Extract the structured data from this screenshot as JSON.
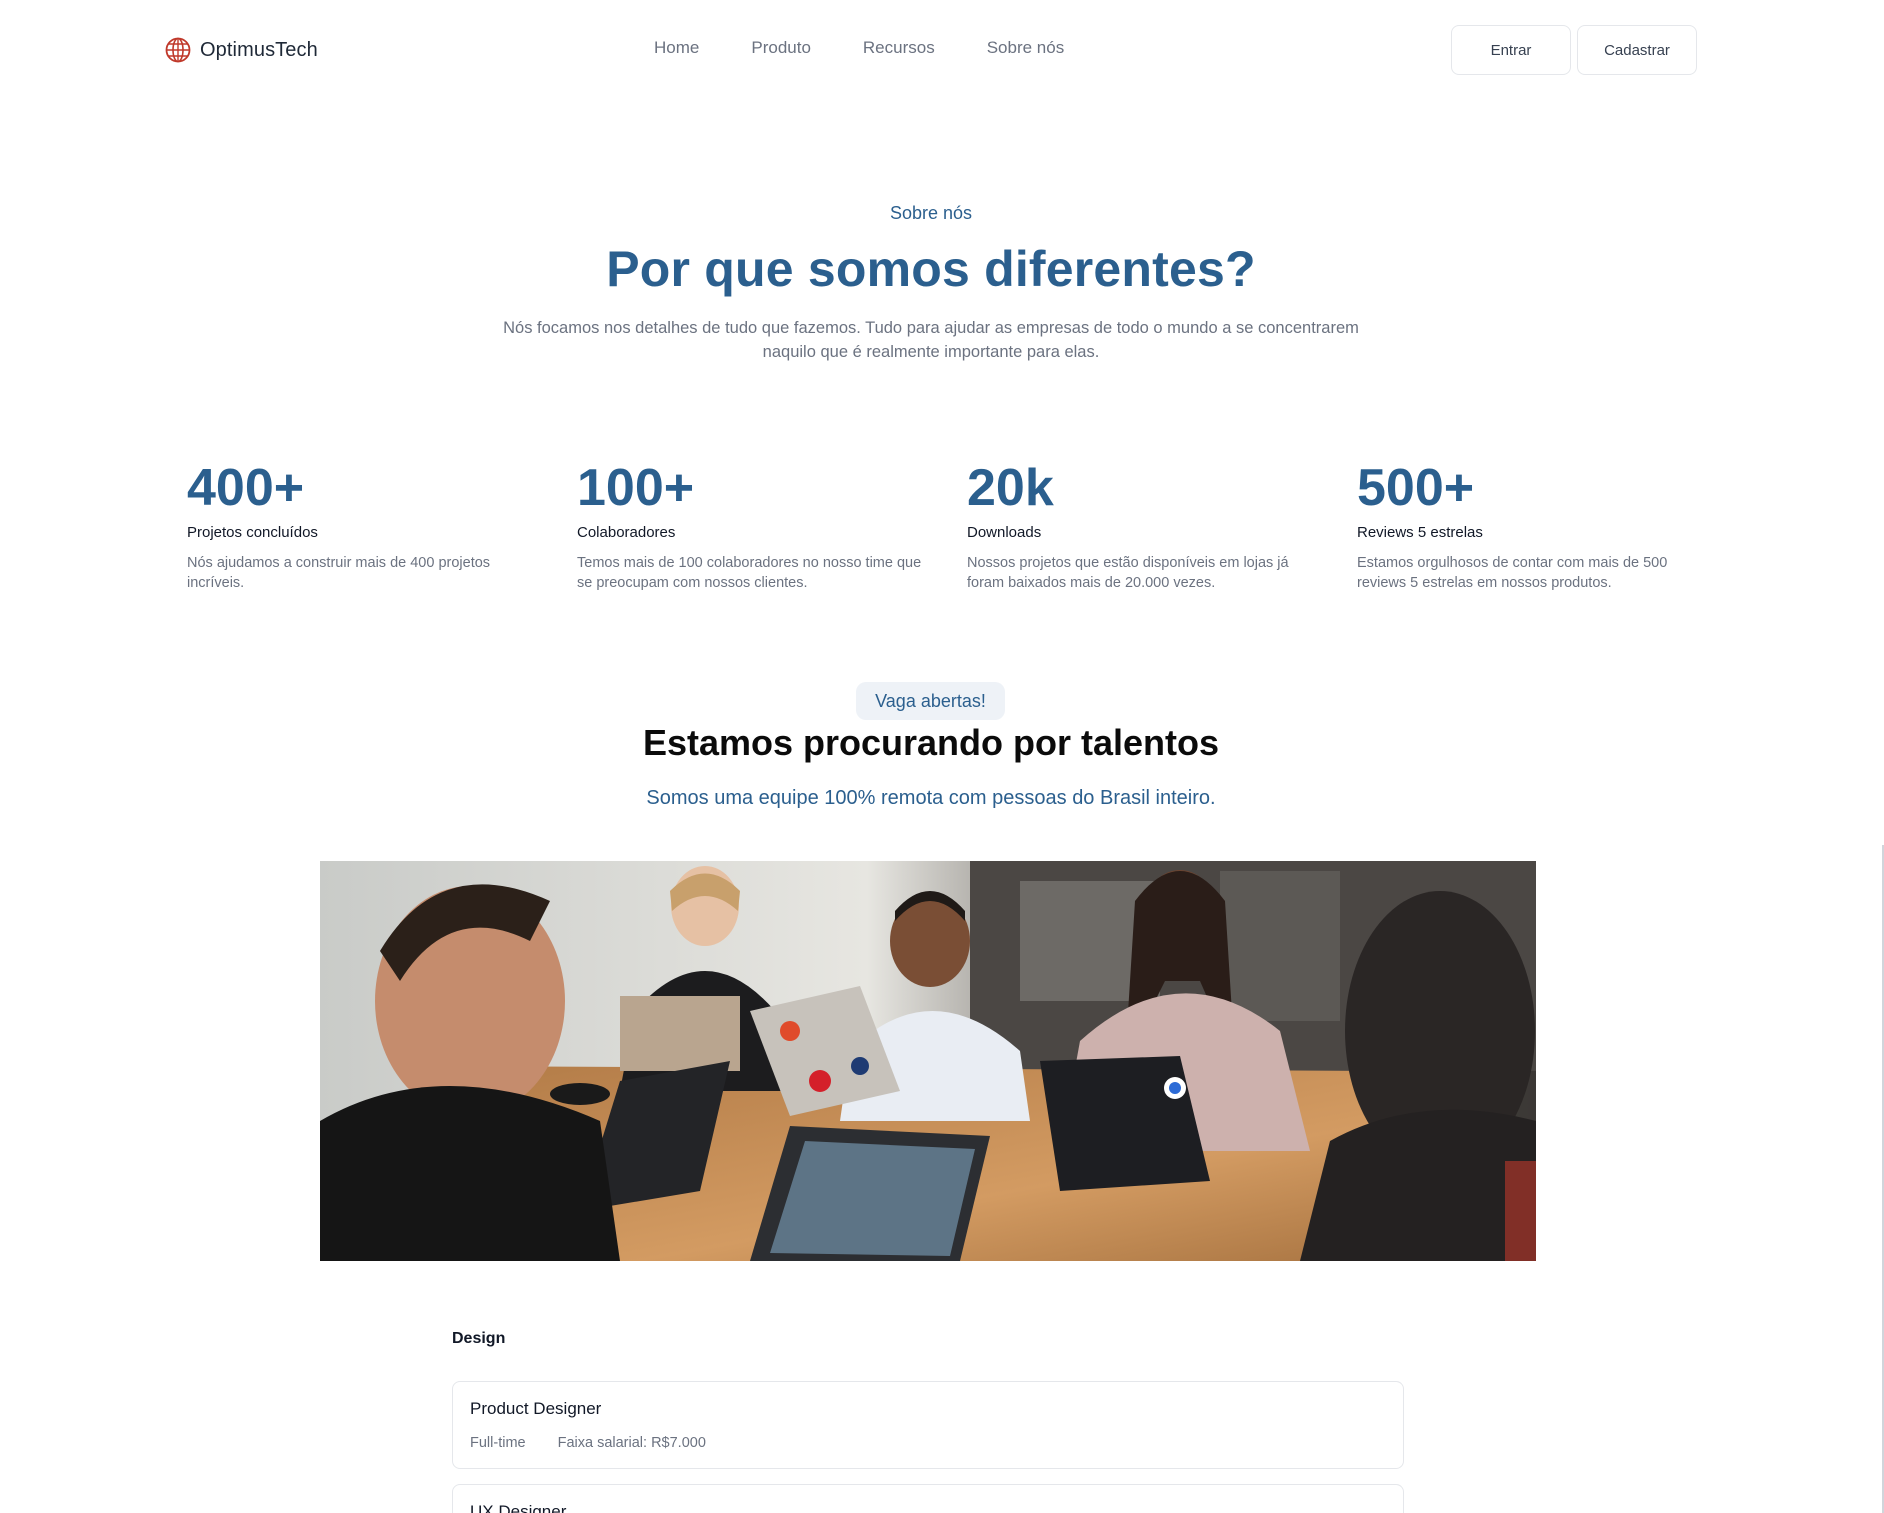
{
  "navbar": {
    "brand": "OptimusTech",
    "links": [
      "Home",
      "Produto",
      "Recursos",
      "Sobre nós"
    ],
    "login_label": "Entrar",
    "signup_label": "Cadastrar"
  },
  "about": {
    "eyebrow": "Sobre nós",
    "title": "Por que somos diferentes?",
    "description": "Nós focamos nos detalhes de tudo que fazemos. Tudo para ajudar as empresas de todo o mundo a se concentrarem naquilo que é realmente importante para elas."
  },
  "stats": [
    {
      "value": "400+",
      "label": "Projetos concluídos",
      "description": "Nós ajudamos a construir mais de 400 projetos incríveis."
    },
    {
      "value": "100+",
      "label": "Colaboradores",
      "description": "Temos mais de 100 colaboradores no nosso time que se preocupam com nossos clientes."
    },
    {
      "value": "20k",
      "label": "Downloads",
      "description": "Nossos projetos que estão disponíveis em lojas já foram baixados mais de 20.000 vezes."
    },
    {
      "value": "500+",
      "label": "Reviews 5 estrelas",
      "description": "Estamos orgulhosos de contar com mais de 500 reviews 5 estrelas em nossos produtos."
    }
  ],
  "hiring": {
    "badge": "Vaga abertas!",
    "title": "Estamos procurando por talentos",
    "subtitle": "Somos uma equipe 100% remota com pessoas do Brasil inteiro.",
    "department": "Design",
    "jobs": [
      {
        "title": "Product Designer",
        "type": "Full-time",
        "salary": "Faixa salarial: R$7.000"
      },
      {
        "title": "UX Designer"
      }
    ]
  },
  "colors": {
    "accent": "#2b5f8e",
    "brand_icon": "#c0392b",
    "muted_text": "#6b7280",
    "border": "#e5e7eb"
  },
  "icons": {
    "brand": "globe-icon"
  }
}
